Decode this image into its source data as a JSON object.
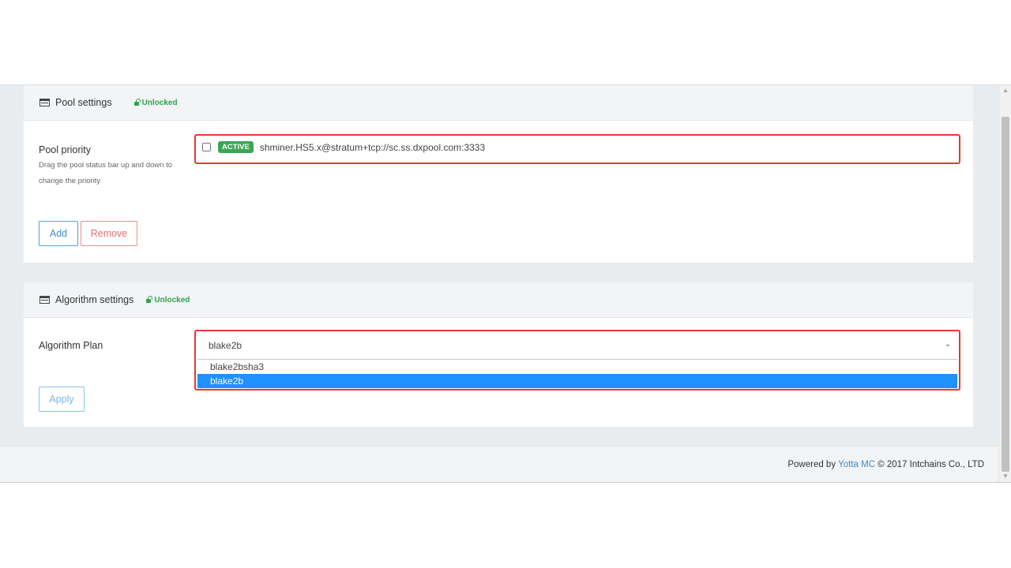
{
  "pool_settings": {
    "title": "Pool settings",
    "lock_status": "Unlocked",
    "priority_label": "Pool priority",
    "priority_help": "Drag the pool status bar up and down to change the priority",
    "pools": [
      {
        "status": "ACTIVE",
        "url": "shminer.HS5.x@stratum+tcp://sc.ss.dxpool.com:3333",
        "checked": false
      }
    ],
    "add_label": "Add",
    "remove_label": "Remove"
  },
  "algorithm_settings": {
    "title": "Algorithm settings",
    "lock_status": "Unlocked",
    "plan_label": "Algorithm Plan",
    "selected_value": "blake2b",
    "options": [
      "blake2bsha3",
      "blake2b"
    ],
    "apply_label": "Apply"
  },
  "footer": {
    "prefix": "Powered by",
    "link_text": "Yotta MC",
    "suffix": "© 2017 Intchains Co., LTD"
  },
  "colors": {
    "accent_blue": "#3a8fd0",
    "active_green": "#3aa655",
    "highlight_red": "#e53935",
    "selection_blue": "#1e90ff"
  }
}
